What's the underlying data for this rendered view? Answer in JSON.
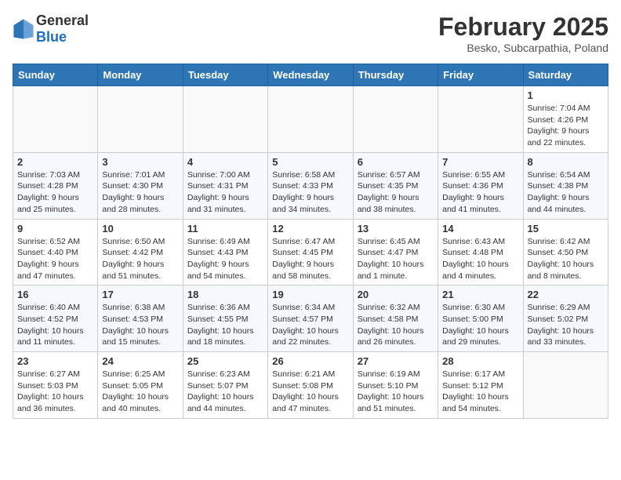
{
  "logo": {
    "general": "General",
    "blue": "Blue"
  },
  "header": {
    "month": "February 2025",
    "location": "Besko, Subcarpathia, Poland"
  },
  "weekdays": [
    "Sunday",
    "Monday",
    "Tuesday",
    "Wednesday",
    "Thursday",
    "Friday",
    "Saturday"
  ],
  "weeks": [
    [
      {
        "day": "",
        "info": ""
      },
      {
        "day": "",
        "info": ""
      },
      {
        "day": "",
        "info": ""
      },
      {
        "day": "",
        "info": ""
      },
      {
        "day": "",
        "info": ""
      },
      {
        "day": "",
        "info": ""
      },
      {
        "day": "1",
        "info": "Sunrise: 7:04 AM\nSunset: 4:26 PM\nDaylight: 9 hours and 22 minutes."
      }
    ],
    [
      {
        "day": "2",
        "info": "Sunrise: 7:03 AM\nSunset: 4:28 PM\nDaylight: 9 hours and 25 minutes."
      },
      {
        "day": "3",
        "info": "Sunrise: 7:01 AM\nSunset: 4:30 PM\nDaylight: 9 hours and 28 minutes."
      },
      {
        "day": "4",
        "info": "Sunrise: 7:00 AM\nSunset: 4:31 PM\nDaylight: 9 hours and 31 minutes."
      },
      {
        "day": "5",
        "info": "Sunrise: 6:58 AM\nSunset: 4:33 PM\nDaylight: 9 hours and 34 minutes."
      },
      {
        "day": "6",
        "info": "Sunrise: 6:57 AM\nSunset: 4:35 PM\nDaylight: 9 hours and 38 minutes."
      },
      {
        "day": "7",
        "info": "Sunrise: 6:55 AM\nSunset: 4:36 PM\nDaylight: 9 hours and 41 minutes."
      },
      {
        "day": "8",
        "info": "Sunrise: 6:54 AM\nSunset: 4:38 PM\nDaylight: 9 hours and 44 minutes."
      }
    ],
    [
      {
        "day": "9",
        "info": "Sunrise: 6:52 AM\nSunset: 4:40 PM\nDaylight: 9 hours and 47 minutes."
      },
      {
        "day": "10",
        "info": "Sunrise: 6:50 AM\nSunset: 4:42 PM\nDaylight: 9 hours and 51 minutes."
      },
      {
        "day": "11",
        "info": "Sunrise: 6:49 AM\nSunset: 4:43 PM\nDaylight: 9 hours and 54 minutes."
      },
      {
        "day": "12",
        "info": "Sunrise: 6:47 AM\nSunset: 4:45 PM\nDaylight: 9 hours and 58 minutes."
      },
      {
        "day": "13",
        "info": "Sunrise: 6:45 AM\nSunset: 4:47 PM\nDaylight: 10 hours and 1 minute."
      },
      {
        "day": "14",
        "info": "Sunrise: 6:43 AM\nSunset: 4:48 PM\nDaylight: 10 hours and 4 minutes."
      },
      {
        "day": "15",
        "info": "Sunrise: 6:42 AM\nSunset: 4:50 PM\nDaylight: 10 hours and 8 minutes."
      }
    ],
    [
      {
        "day": "16",
        "info": "Sunrise: 6:40 AM\nSunset: 4:52 PM\nDaylight: 10 hours and 11 minutes."
      },
      {
        "day": "17",
        "info": "Sunrise: 6:38 AM\nSunset: 4:53 PM\nDaylight: 10 hours and 15 minutes."
      },
      {
        "day": "18",
        "info": "Sunrise: 6:36 AM\nSunset: 4:55 PM\nDaylight: 10 hours and 18 minutes."
      },
      {
        "day": "19",
        "info": "Sunrise: 6:34 AM\nSunset: 4:57 PM\nDaylight: 10 hours and 22 minutes."
      },
      {
        "day": "20",
        "info": "Sunrise: 6:32 AM\nSunset: 4:58 PM\nDaylight: 10 hours and 26 minutes."
      },
      {
        "day": "21",
        "info": "Sunrise: 6:30 AM\nSunset: 5:00 PM\nDaylight: 10 hours and 29 minutes."
      },
      {
        "day": "22",
        "info": "Sunrise: 6:29 AM\nSunset: 5:02 PM\nDaylight: 10 hours and 33 minutes."
      }
    ],
    [
      {
        "day": "23",
        "info": "Sunrise: 6:27 AM\nSunset: 5:03 PM\nDaylight: 10 hours and 36 minutes."
      },
      {
        "day": "24",
        "info": "Sunrise: 6:25 AM\nSunset: 5:05 PM\nDaylight: 10 hours and 40 minutes."
      },
      {
        "day": "25",
        "info": "Sunrise: 6:23 AM\nSunset: 5:07 PM\nDaylight: 10 hours and 44 minutes."
      },
      {
        "day": "26",
        "info": "Sunrise: 6:21 AM\nSunset: 5:08 PM\nDaylight: 10 hours and 47 minutes."
      },
      {
        "day": "27",
        "info": "Sunrise: 6:19 AM\nSunset: 5:10 PM\nDaylight: 10 hours and 51 minutes."
      },
      {
        "day": "28",
        "info": "Sunrise: 6:17 AM\nSunset: 5:12 PM\nDaylight: 10 hours and 54 minutes."
      },
      {
        "day": "",
        "info": ""
      }
    ]
  ]
}
